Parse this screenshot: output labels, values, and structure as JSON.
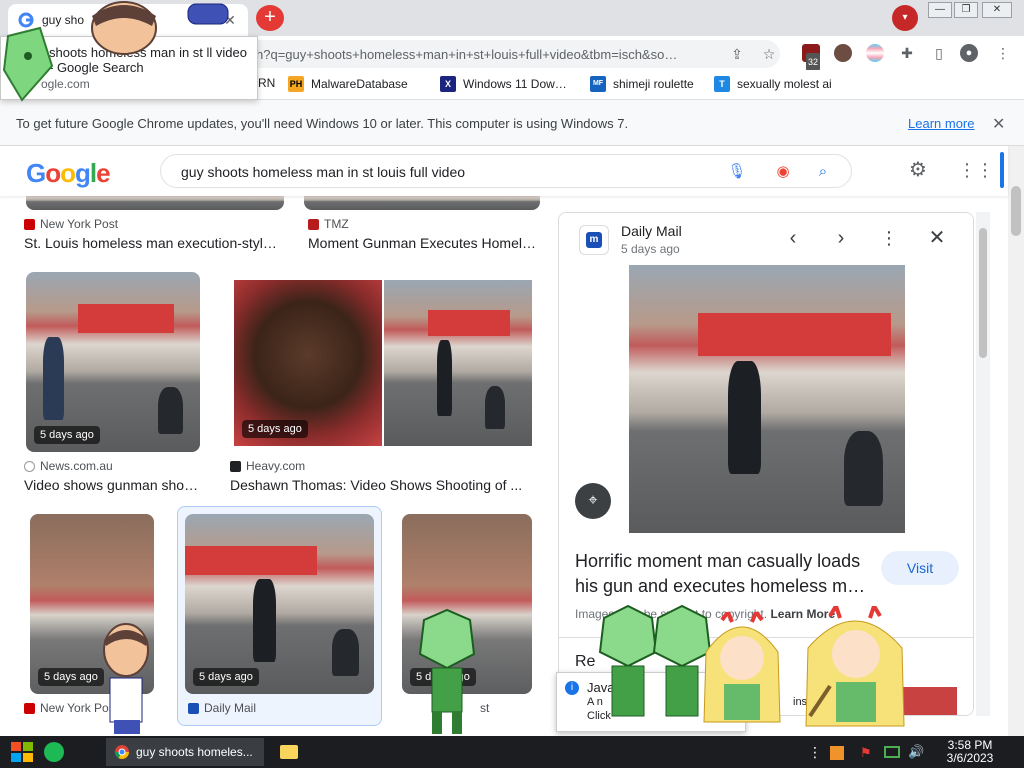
{
  "browser": {
    "tab_title": "guy shoots homeless man in st louis full video - Google Search",
    "tab_title_short": "guy sho",
    "url": "h?q=guy+shoots+homeless+man+in+st+louis+full+video&tbm=isch&so…",
    "extension_badge": "32"
  },
  "tooltip": {
    "title": "shoots homeless man in st ll video - Google Search",
    "url": "ogle.com"
  },
  "bookmarks": [
    {
      "label": "RN",
      "icon": "bookmark-icon",
      "color": "#e8eaed"
    },
    {
      "label": "MalwareDatabase",
      "icon": "PH",
      "color": "#f5a623"
    },
    {
      "label": "Windows 11 Dow…",
      "icon": "X",
      "color": "#1a237e"
    },
    {
      "label": "shimeji roulette",
      "icon": "MF",
      "color": "#1565c0"
    },
    {
      "label": "sexually molest ai",
      "icon": "T",
      "color": "#1e88e5"
    }
  ],
  "infobar": {
    "message": "To get future Google Chrome updates, you'll need Windows 10 or later. This computer is using Windows 7.",
    "learn_more": "Learn more"
  },
  "search": {
    "logo": "Google",
    "query": "guy shoots homeless man in st louis full video"
  },
  "results": {
    "row0": [
      {
        "source": "New York Post",
        "title": "St. Louis homeless man execution-styl…",
        "color": "#cc0000"
      },
      {
        "source": "TMZ",
        "title": "Moment Gunman Executes Homel…",
        "color": "#c62828"
      }
    ],
    "row1": [
      {
        "badge": "5 days ago",
        "source": "News.com.au",
        "title": "Video shows gunman sho…"
      },
      {
        "badge": "5 days ago",
        "source": "Heavy.com",
        "title": "Deshawn Thomas: Video Shows Shooting of ..."
      }
    ],
    "row2": [
      {
        "badge": "5 days ago",
        "source": "New York Post"
      },
      {
        "badge": "5 days ago",
        "source": "Daily Mail"
      },
      {
        "badge": "5 days ago",
        "source": "st"
      }
    ]
  },
  "panel": {
    "source": "Daily Mail",
    "age": "5 days ago",
    "title": "Horrific moment man casually loads his gun and executes homeless m…",
    "visit": "Visit",
    "note_prefix": "Images may be subject to copyright.",
    "note_link": "Learn More",
    "related": "Re"
  },
  "toast": {
    "line1": "Java",
    "line2": "A n",
    "line3": "Click",
    "suffix": "insta"
  },
  "taskbar": {
    "window_label": "guy shoots homeles...",
    "time": "3:58 PM",
    "date": "3/6/2023"
  },
  "colors": {
    "google_blue": "#4285f4",
    "google_red": "#ea4335",
    "google_yellow": "#fbbc05",
    "google_green": "#34a853",
    "link": "#1a73e8"
  }
}
